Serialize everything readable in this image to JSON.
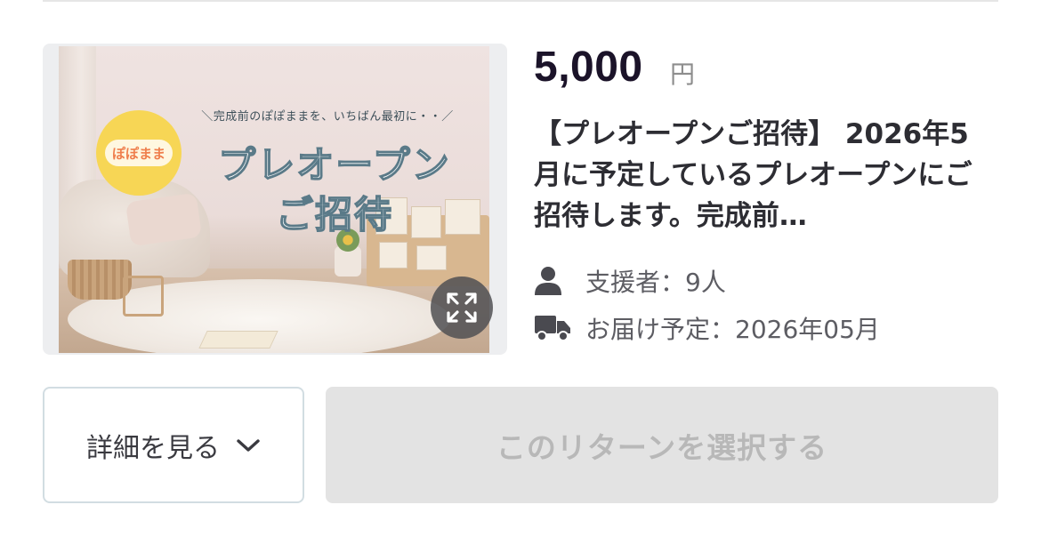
{
  "reward": {
    "image": {
      "logo_text": "ぽぽまま",
      "tagline": "＼完成前のぽぽままを、いちばん最初に・・／",
      "headline_line1": "プレオープン",
      "headline_line2": "ご招待"
    },
    "price": "5,000",
    "currency": "円",
    "title": "【プレオープンご招待】 2026年5月に予定しているプレオープンにご招待します。完成前…",
    "supporters": "支援者：9人",
    "delivery": "お届け予定：2026年05月"
  },
  "buttons": {
    "details_label": "詳細を見る",
    "select_label": "このリターンを選択する"
  },
  "icons": {
    "supporters": "person-icon",
    "delivery": "truck-icon",
    "expand": "expand-icon",
    "details": "chevron-down-icon"
  },
  "colors": {
    "price": "#1b1329",
    "select_button_bg": "#e3e3e3",
    "select_button_text": "#b8b8b8",
    "details_border": "#d2dde2",
    "logo_circle": "#f7d655"
  }
}
